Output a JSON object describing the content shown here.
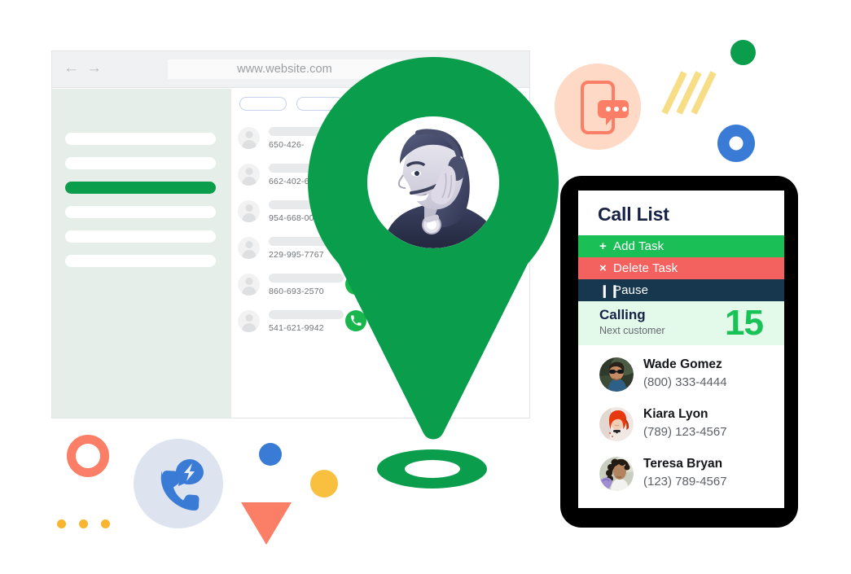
{
  "browser": {
    "url": "www.website.com",
    "back_icon": "arrow-left-icon",
    "forward_icon": "arrow-right-icon",
    "sidebar": {
      "items": [
        {
          "label": "",
          "active": false
        },
        {
          "label": "",
          "active": false
        },
        {
          "label": "",
          "active": true
        },
        {
          "label": "",
          "active": false
        },
        {
          "label": "",
          "active": false
        },
        {
          "label": "",
          "active": false
        }
      ]
    },
    "toolbar_pills": [
      "",
      ""
    ],
    "contacts": [
      {
        "phone": "650-426-",
        "has_call_button": false
      },
      {
        "phone": "662-402-62",
        "has_call_button": false
      },
      {
        "phone": "954-668-0057",
        "has_call_button": false
      },
      {
        "phone": "229-995-7767",
        "has_call_button": false
      },
      {
        "phone": "860-693-2570",
        "has_call_button": true
      },
      {
        "phone": "541-621-9942",
        "has_call_button": true
      }
    ]
  },
  "pin": {
    "icon": "map-pin-icon",
    "photo_alt": "call-center-agent-with-headset"
  },
  "tablet": {
    "title": "Call List",
    "actions": [
      {
        "glyph": "+",
        "label": "Add Task",
        "icon": "plus-icon",
        "color": "#1ac056"
      },
      {
        "glyph": "×",
        "label": "Delete Task",
        "icon": "close-icon",
        "color": "#f4625f"
      },
      {
        "glyph": "❙❙",
        "label": "Pause",
        "icon": "pause-icon",
        "color": "#17374f"
      }
    ],
    "calling": {
      "label": "Calling",
      "sublabel": "Next customer",
      "count": "15",
      "count_color": "#18c257"
    },
    "contacts": [
      {
        "name": "Wade Gomez",
        "phone": "(800) 333-4444",
        "avatar": "avatar-man-sunglasses"
      },
      {
        "name": "Kiara Lyon",
        "phone": "(789) 123-4567",
        "avatar": "avatar-woman-red-hair"
      },
      {
        "name": "Teresa Bryan",
        "phone": "(123) 789-4567",
        "avatar": "avatar-woman-curly-hair"
      }
    ]
  },
  "decor": {
    "phone_chat_icon": "phone-chat-icon",
    "call_bolt_icon": "phone-lightning-icon",
    "stripes_icon": "diagonal-stripes",
    "green_dot": "#0a9d4b",
    "blue_ring": "#3a7bd5",
    "coral": "#fb7e67",
    "yellow": "#f9c03f",
    "peach": "#fdd9c6",
    "lavender": "#dde4f0"
  },
  "colors": {
    "brand_green": "#0a9d4b",
    "accent_green": "#1ac056",
    "danger_red": "#f4625f",
    "navy": "#17374f",
    "mint_bg": "#e3f9ea"
  }
}
